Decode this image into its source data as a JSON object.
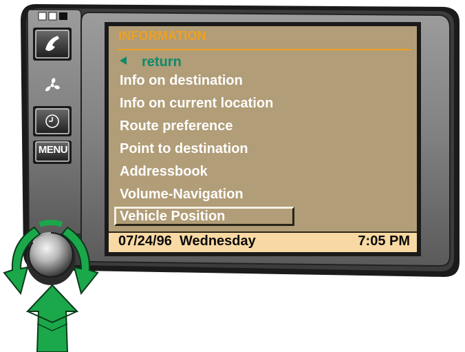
{
  "screen": {
    "title": "INFORMATION",
    "return_label": "return",
    "menu_items": [
      "Info on destination",
      "Info on current location",
      "Route preference",
      "Point to destination",
      "Addressbook",
      "Volume-Navigation"
    ],
    "selected_item": "Vehicle Position"
  },
  "status_bar": {
    "date": "07/24/96",
    "day": "Wednesday",
    "date_line": "07/24/96  Wednesday",
    "time": "7:05 PM"
  },
  "buttons": {
    "phone_icon": "phone-icon",
    "fan_icon": "fan-icon",
    "clock_icon": "clock-icon",
    "menu_label": "MENU"
  },
  "colors": {
    "screen_bg": "#b19d77",
    "title": "#f0a020",
    "return": "#0e8a6b",
    "status_bar_bg": "#f8d9a3",
    "arrows": "#1aa84a",
    "bezel": "#7a7a7a"
  }
}
